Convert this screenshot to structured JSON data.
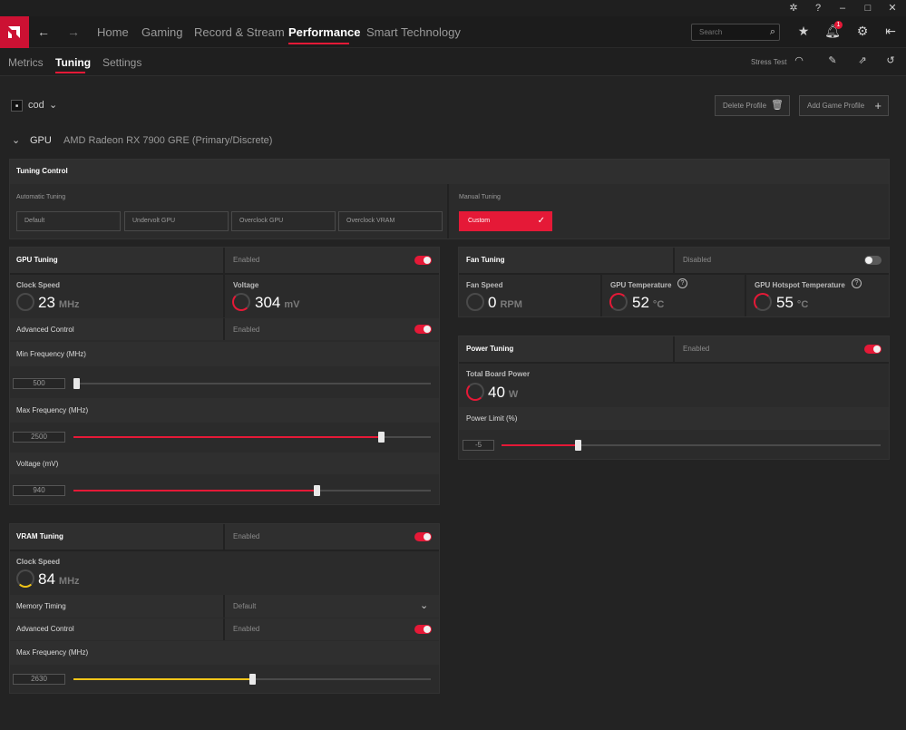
{
  "nav": {
    "items": [
      {
        "label": "Home"
      },
      {
        "label": "Gaming"
      },
      {
        "label": "Record & Stream"
      },
      {
        "label": "Performance"
      },
      {
        "label": "Smart Technology"
      }
    ],
    "search_placeholder": "Search",
    "notification_count": "1"
  },
  "subnav": {
    "items": [
      {
        "label": "Metrics"
      },
      {
        "label": "Tuning"
      },
      {
        "label": "Settings"
      }
    ],
    "stress_test": "Stress Test"
  },
  "profile": {
    "name": "cod",
    "delete_label": "Delete Profile",
    "add_label": "Add Game Profile"
  },
  "gpu": {
    "label": "GPU",
    "name": "AMD Radeon RX 7900 GRE (Primary/Discrete)"
  },
  "tuning_control": {
    "title": "Tuning Control",
    "automatic_label": "Automatic Tuning",
    "manual_label": "Manual Tuning",
    "auto_options": [
      "Default",
      "Undervolt GPU",
      "Overclock GPU",
      "Overclock VRAM"
    ],
    "manual_option": "Custom"
  },
  "gpu_tuning": {
    "title": "GPU Tuning",
    "status": "Enabled",
    "enabled": true,
    "clock_label": "Clock Speed",
    "clock_value": "23",
    "clock_unit": "MHz",
    "voltage_label": "Voltage",
    "voltage_value": "304",
    "voltage_unit": "mV",
    "advanced_label": "Advanced Control",
    "advanced_status": "Enabled",
    "min_freq_label": "Min Frequency (MHz)",
    "min_freq_value": "500",
    "min_freq_fraction": 0.0,
    "max_freq_label": "Max Frequency (MHz)",
    "max_freq_value": "2500",
    "max_freq_fraction": 0.86,
    "voltage_slider_label": "Voltage (mV)",
    "voltage_slider_value": "940",
    "voltage_slider_fraction": 0.68
  },
  "fan_tuning": {
    "title": "Fan Tuning",
    "status": "Disabled",
    "fan_label": "Fan Speed",
    "fan_value": "0",
    "fan_unit": "RPM",
    "temp_label": "GPU Temperature",
    "temp_value": "52",
    "temp_unit": "°C",
    "hotspot_label": "GPU Hotspot Temperature",
    "hotspot_value": "55",
    "hotspot_unit": "°C"
  },
  "power_tuning": {
    "title": "Power Tuning",
    "status": "Enabled",
    "tbp_label": "Total Board Power",
    "tbp_value": "40",
    "tbp_unit": "W",
    "limit_label": "Power Limit (%)",
    "limit_value": "-5",
    "limit_fraction": 0.2
  },
  "vram_tuning": {
    "title": "VRAM Tuning",
    "status": "Enabled",
    "clock_label": "Clock Speed",
    "clock_value": "84",
    "clock_unit": "MHz",
    "memory_timing_label": "Memory Timing",
    "memory_timing_value": "Default",
    "advanced_label": "Advanced Control",
    "advanced_status": "Enabled",
    "max_freq_label": "Max Frequency (MHz)",
    "max_freq_value": "2630",
    "max_freq_fraction": 0.5
  },
  "colors": {
    "accent": "#e51937",
    "vram_fill": "#f0c419"
  }
}
